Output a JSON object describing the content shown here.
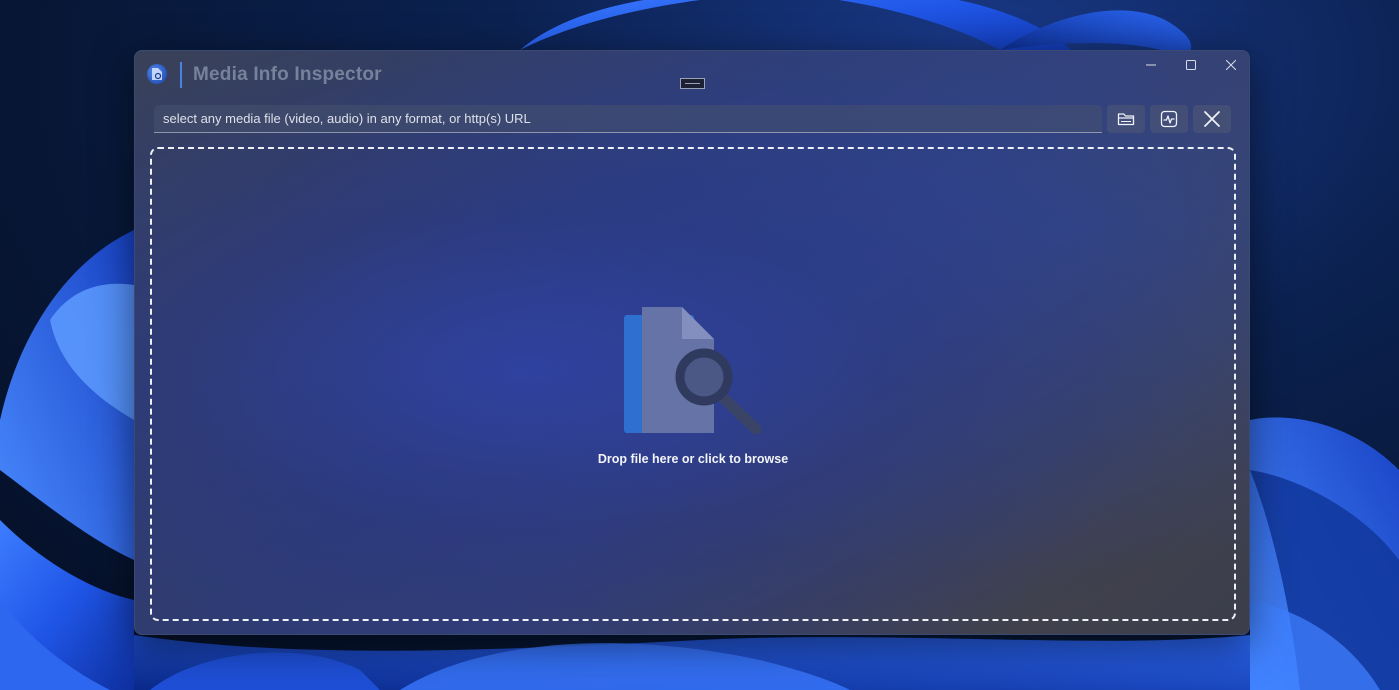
{
  "window": {
    "title": "Media Info Inspector"
  },
  "toolbar": {
    "path_placeholder": "select any media file (video, audio) in any format, or http(s) URL",
    "path_value": "",
    "buttons": [
      {
        "name": "open-file",
        "icon": "folder-open-icon"
      },
      {
        "name": "analyze",
        "icon": "waveform-icon"
      },
      {
        "name": "clear",
        "icon": "close-icon"
      }
    ]
  },
  "dropzone": {
    "label": "Drop file here or click to browse",
    "icon": "file-search-icon"
  },
  "colors": {
    "accent": "#4a82e0",
    "title_text": "#76819a",
    "dropzone_border": "#eef1f7",
    "icon_blue": "#2f6fd0",
    "icon_page": "#6573a6"
  }
}
